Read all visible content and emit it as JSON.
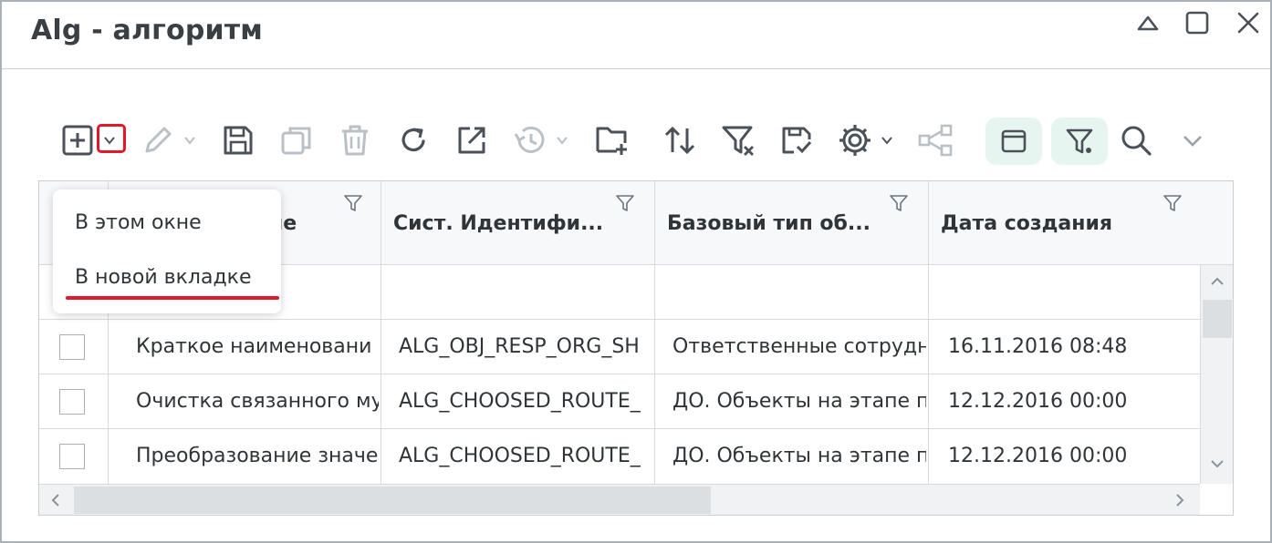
{
  "window": {
    "title": "Alg - алгоритм",
    "controls": [
      "collapse-icon",
      "maximize-icon",
      "close-icon"
    ]
  },
  "toolbar": {
    "icons": [
      "add-icon",
      "dropdown-caret-icon",
      "edit-icon",
      "save-icon",
      "copy-icon",
      "delete-icon",
      "refresh-icon",
      "open-external-icon",
      "history-icon",
      "add-folder-icon",
      "sort-icon",
      "clear-filter-icon",
      "save-filter-icon",
      "settings-icon",
      "hierarchy-icon",
      "panel-icon",
      "filter-toggle-icon",
      "search-icon",
      "expand-caret-icon"
    ]
  },
  "dropdown_menu": {
    "items": [
      "В этом окне",
      "В новой вкладке"
    ],
    "highlighted": "В новой вкладке"
  },
  "table": {
    "columns": [
      "Наименование",
      "Сист. Идентифи...",
      "Базовый тип об...",
      "Дата создания"
    ],
    "visible_header_fragment": "не",
    "rows": [
      {
        "name": "Краткое наименовани",
        "sys_id": "ALG_OBJ_RESP_ORG_SH",
        "base_type": "Ответственные сотрудн",
        "created": "16.11.2016 08:48"
      },
      {
        "name": "Очистка связанного му",
        "sys_id": "ALG_CHOOSED_ROUTE_",
        "base_type": "ДО. Объекты на этапе п",
        "created": "12.12.2016 00:00"
      },
      {
        "name": "Преобразование значе",
        "sys_id": "ALG_CHOOSED_ROUTE_",
        "base_type": "ДО. Объекты на этапе п",
        "created": "12.12.2016 00:00"
      }
    ]
  },
  "colors": {
    "highlight_red": "#e0192c",
    "active_pill": "#e6f5ef",
    "icon_dark": "#4a5158",
    "icon_disabled": "#b9c0c6"
  }
}
